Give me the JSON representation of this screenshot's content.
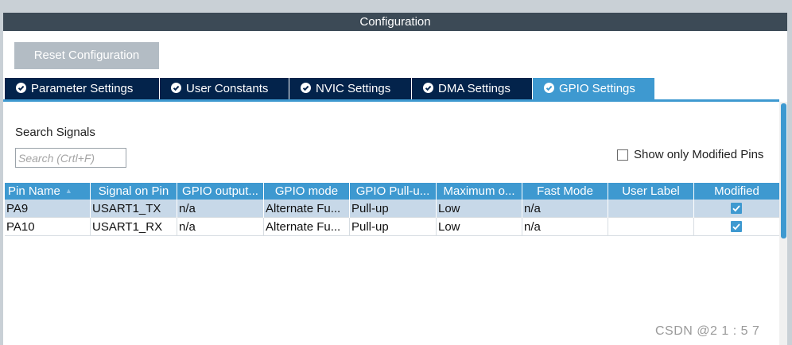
{
  "window": {
    "title": "Configuration"
  },
  "toolbar": {
    "reset_label": "Reset Configuration"
  },
  "tabs": [
    {
      "label": "Parameter Settings",
      "icon": "check-circle-icon",
      "active": false
    },
    {
      "label": "User Constants",
      "icon": "check-circle-icon",
      "active": false
    },
    {
      "label": "NVIC Settings",
      "icon": "check-circle-icon",
      "active": false
    },
    {
      "label": "DMA Settings",
      "icon": "check-circle-icon",
      "active": false
    },
    {
      "label": "GPIO Settings",
      "icon": "check-circle-icon",
      "active": true
    }
  ],
  "search": {
    "label": "Search Signals",
    "placeholder": "Search (Crtl+F)",
    "value": ""
  },
  "filter": {
    "label": "Show only Modified Pins",
    "checked": false
  },
  "table": {
    "columns": [
      "Pin Name",
      "Signal on Pin",
      "GPIO output...",
      "GPIO mode",
      "GPIO Pull-u...",
      "Maximum o...",
      "Fast Mode",
      "User Label",
      "Modified"
    ],
    "rows": [
      {
        "cells": [
          "PA9",
          "USART1_TX",
          "n/a",
          "Alternate Fu...",
          "Pull-up",
          "Low",
          "n/a",
          ""
        ],
        "modified": true,
        "selected": true
      },
      {
        "cells": [
          "PA10",
          "USART1_RX",
          "n/a",
          "Alternate Fu...",
          "Pull-up",
          "Low",
          "n/a",
          ""
        ],
        "modified": true,
        "selected": false
      }
    ]
  },
  "watermark": "CSDN @2 1 : 5 7",
  "colors": {
    "titlebar": "#3c4a56",
    "tab_inactive": "#03234b",
    "accent": "#3e99d0",
    "selected_row": "#c7d8e8",
    "disabled_button": "#b3bcc4"
  }
}
